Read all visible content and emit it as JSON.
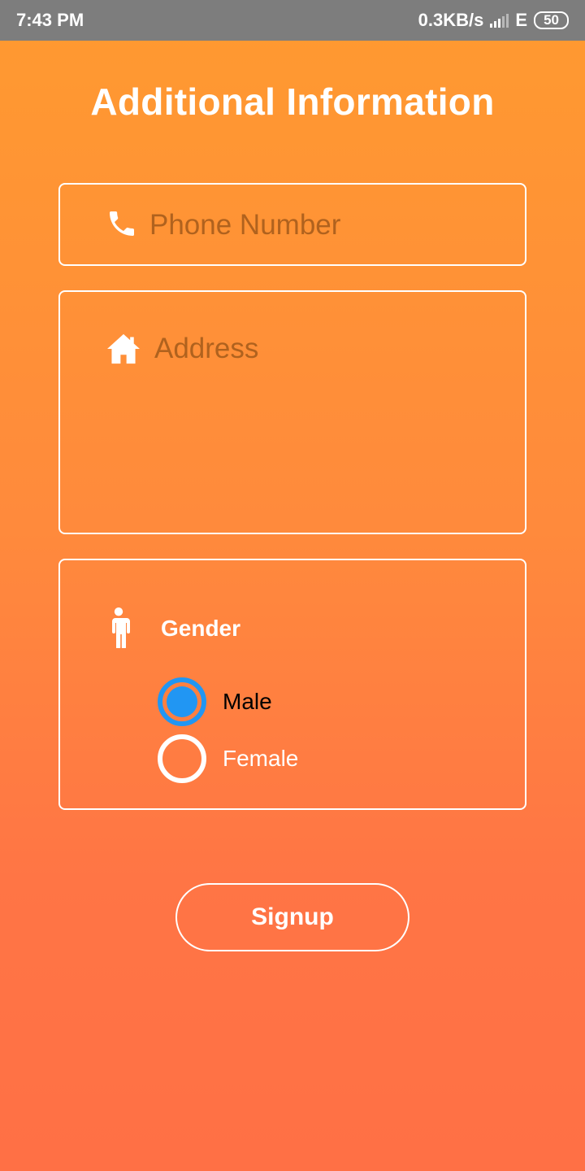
{
  "status_bar": {
    "time": "7:43 PM",
    "speed": "0.3KB/s",
    "network": "E",
    "battery": "50"
  },
  "title": "Additional Information",
  "phone": {
    "placeholder": "Phone Number",
    "icon": "phone-icon"
  },
  "address": {
    "placeholder": "Address",
    "icon": "home-icon"
  },
  "gender": {
    "label": "Gender",
    "icon": "person-icon",
    "options": [
      {
        "label": "Male",
        "selected": true
      },
      {
        "label": "Female",
        "selected": false
      }
    ]
  },
  "signup_label": "Signup",
  "colors": {
    "gradient_top": "#FF9A30",
    "gradient_bottom": "#FF7045",
    "radio_accent": "#2196F3",
    "placeholder": "#B0621E"
  }
}
